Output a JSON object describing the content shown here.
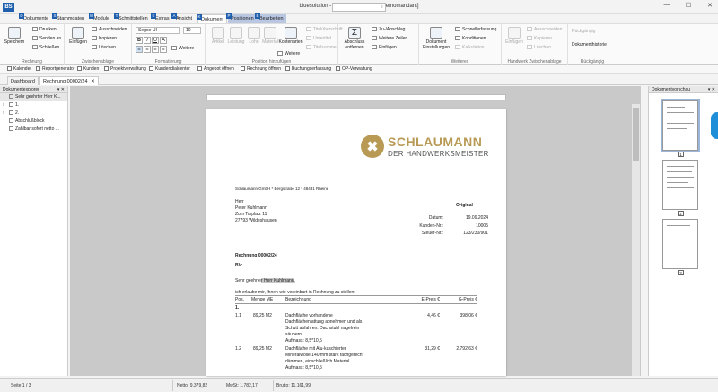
{
  "app": {
    "logo": "BS",
    "title": "bluesolution - smarthandwerk pro [Demomandant]",
    "search_placeholder": "",
    "search_icon": "search-icon"
  },
  "window_buttons": {
    "minimize": "—",
    "maximize": "☐",
    "close": "✕"
  },
  "tabs": [
    {
      "label": "Dokumente",
      "badge": "D"
    },
    {
      "label": "Stammdaten",
      "badge": "S"
    },
    {
      "label": "Module",
      "badge": "M"
    },
    {
      "label": "Schnittstellen",
      "badge": "T"
    },
    {
      "label": "Extras",
      "badge": "E"
    },
    {
      "label": "Ansicht",
      "badge": "A"
    },
    {
      "label": "Dokument",
      "badge": "K"
    },
    {
      "label": "Positionen",
      "badge": "P"
    },
    {
      "label": "Bearbeiten",
      "badge": "B"
    }
  ],
  "ribbon": {
    "rechnung": {
      "label": "Rechnung",
      "speichern": "Speichern",
      "drucken": "Drucken",
      "senden": "Senden an",
      "schliessen": "Schließen"
    },
    "zwischenablage": {
      "label": "Zwischenablage",
      "einfuegen": "Einfügen",
      "ausschneiden": "Ausschneiden",
      "kopieren": "Kopieren",
      "loeschen": "Löschen"
    },
    "formatierung": {
      "label": "Formatierung",
      "font": "Segoe UI",
      "size": "10",
      "weitere": "Weitere"
    },
    "positionen": {
      "label": "Position hinzufügen",
      "artikel": "Artikel",
      "leistung": "Leistung",
      "lohn": "Lohn",
      "material": "Material",
      "kostenarten": "Kostenarten",
      "weitere": "Weitere",
      "titelueberschrift": "Titelüberschrift",
      "untertitel": "Untertitel",
      "titelsumme": "Titelsumme"
    },
    "abschluss": {
      "label": "Abschluss entfernen",
      "zu_abschlag": "Zu-/Abschlag",
      "weitere_zeilen": "Weitere Zeilen",
      "einfuegen": "Einfügen"
    },
    "weiteres": {
      "label": "Weiteres",
      "dokument_einstellungen": "Dokument Einstellungen",
      "schnellerfassung": "Schnellerfassung",
      "konditionen": "Konditionen",
      "kalkulation": "Kalkulation"
    },
    "handwerk": {
      "label": "Handwerk Zwischenablage",
      "einfuegen": "Einfügen",
      "ausschneiden": "Ausschneiden",
      "kopieren": "Kopieren",
      "loeschen": "Löschen"
    },
    "rueckgaengig": {
      "label": "Rückgängig",
      "top": "Rückgängig",
      "historie": "Dokumenthistorie"
    }
  },
  "quicktoolbar": [
    "Kalender",
    "Reportgenerator",
    "Kunden",
    "Projektverwaltung",
    "Kundendialcenter",
    "Angebot öffnen",
    "Rechnung öffnen",
    "Buchungserfassung",
    "OP-Verwaltung"
  ],
  "doctabs": [
    "Dashboard",
    "Rechnung 00002/24"
  ],
  "doctab_close": "✕",
  "left_panel": {
    "title": "Dokumentexplorer",
    "pin": "▾ ✕",
    "items": [
      {
        "label": "Sehr geehrter Herr K...",
        "expander": ""
      },
      {
        "label": "1.",
        "expander": "›"
      },
      {
        "label": "2.",
        "expander": "›"
      },
      {
        "label": "Abschlußblock",
        "expander": ""
      },
      {
        "label": "Zahlbar sofort netto ...",
        "expander": ""
      }
    ]
  },
  "document": {
    "logo_name": "SCHLAUMANN",
    "logo_tag": "DER HANDWERKSMEISTER",
    "sender_line": "Schlaumann GmbH * Bergstraße 12 * 48431 Rheine",
    "original": "Original",
    "recipient": [
      "Herr",
      "Peter Kuhlmann",
      "Zum Torplatz 11",
      "27793 Wildeshausen"
    ],
    "meta": [
      {
        "label": "Datum:",
        "value": "19.09.2024"
      },
      {
        "label": "Kunden-Nr.:",
        "value": "10005"
      },
      {
        "label": "Steuer-Nr.:",
        "value": "123/230/901"
      }
    ],
    "heading": "Rechnung 00002/24",
    "bv": "BV:",
    "salutation_a": "Sehr geehrte",
    "salutation_b": "r Herr Kuhlmann",
    "salutation_c": ",",
    "intro": "ich erlaube mir, Ihnen wie vereinbart in Rechnung zu stellen:",
    "columns": {
      "pos": "Pos.",
      "menge": "Menge ME",
      "bez": "Bezeichnung",
      "epreis": "E-Preis €",
      "gpreis": "G-Preis €"
    },
    "section": "1.",
    "rows": [
      {
        "pos": "1.1",
        "menge": "89,25 M2",
        "lines": [
          "Dachfläche vorhandene",
          "Dachflächenlattung abnehmen und als",
          "Schutt abfahren. Dachstuhl nagelrein",
          "säubern.",
          "Aufmass: 8,5*10,5"
        ],
        "e": "4,46 €",
        "g": "398,06 €"
      },
      {
        "pos": "1.2",
        "menge": "89,25 M2",
        "lines": [
          "Dachfläche mit Alu-kaschierter",
          "Mineralwolle 140 mm stark fachgerecht",
          "dämmen, einschließlich Material.",
          "Aufmass: 8,5*10,5"
        ],
        "e": "31,29 €",
        "g": "2.792,63 €"
      }
    ]
  },
  "right_panel": {
    "title": "Dokumentvorschau",
    "pin": "▾ ✕",
    "pages": [
      "1",
      "2",
      "3"
    ]
  },
  "status": {
    "seite": "Seite 1 / 3",
    "netto": "Netto: 9.379,82",
    "mwst": "MwSt: 1.782,17",
    "brutto": "Brutto: 11.161,99"
  }
}
